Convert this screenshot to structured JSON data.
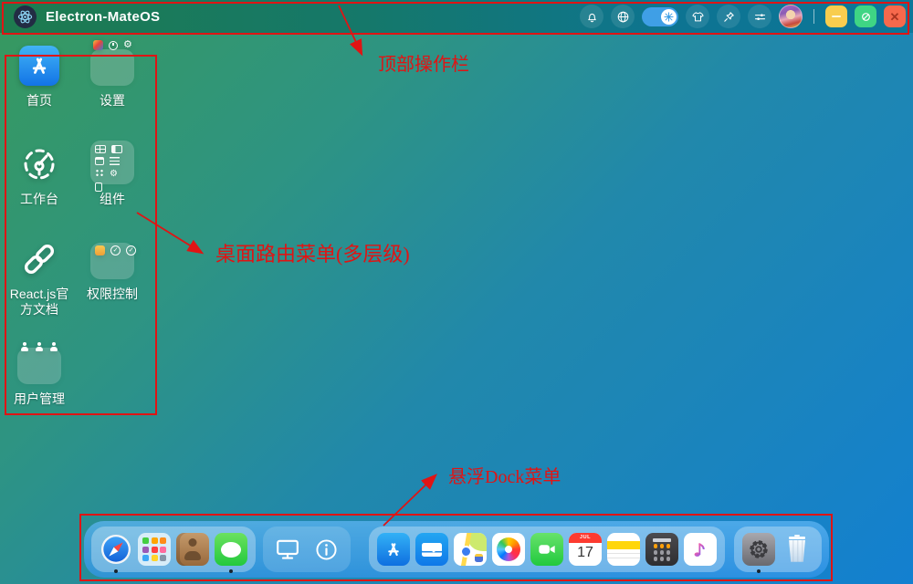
{
  "window": {
    "title": "Electron-MateOS"
  },
  "topbar": {
    "icon_names": [
      "app-logo-atom",
      "notifications-bell",
      "language-globe",
      "snow-effect-toggle-on",
      "theme-tshirt",
      "pin",
      "preferences-sliders",
      "user-avatar",
      "divider",
      "minimize",
      "maximize",
      "close"
    ]
  },
  "desktop": {
    "icons": [
      {
        "label": "首页",
        "type": "app",
        "icon": "app-store-a"
      },
      {
        "label": "设置",
        "type": "folder",
        "mini_icons": [
          "colorful-app",
          "clock",
          "gear"
        ]
      },
      {
        "label": "工作台",
        "type": "app",
        "icon": "dashboard-gauge"
      },
      {
        "label": "组件",
        "type": "folder",
        "mini_icons": [
          "table",
          "card",
          "window",
          "list",
          "grid",
          "gear",
          "document"
        ]
      },
      {
        "label": "React.js官方文档",
        "type": "app",
        "icon": "link-chain"
      },
      {
        "label": "权限控制",
        "type": "folder",
        "mini_icons": [
          "user-badge",
          "shield-check",
          "shield-check"
        ]
      },
      {
        "label": "用户管理",
        "type": "folder",
        "mini_icons": [
          "user",
          "user",
          "user"
        ]
      }
    ]
  },
  "annotations": [
    {
      "text": "顶部操作栏"
    },
    {
      "text": "桌面路由菜单(多层级)"
    },
    {
      "text": "悬浮Dock菜单"
    }
  ],
  "dock": {
    "groups": [
      {
        "items": [
          {
            "name": "safari",
            "running": true
          },
          {
            "name": "launchpad",
            "running": false
          },
          {
            "name": "contacts",
            "running": false
          },
          {
            "name": "messages",
            "running": true
          }
        ]
      },
      {
        "items": [
          {
            "name": "display",
            "running": false
          },
          {
            "name": "info",
            "running": false
          }
        ]
      },
      {
        "items": [
          {
            "name": "app-store",
            "running": false
          },
          {
            "name": "mail",
            "running": false
          },
          {
            "name": "maps",
            "running": true
          },
          {
            "name": "photos",
            "running": false
          },
          {
            "name": "facetime",
            "running": false
          },
          {
            "name": "calendar",
            "running": false
          },
          {
            "name": "notes",
            "running": false
          },
          {
            "name": "calculator",
            "running": false
          },
          {
            "name": "music",
            "running": false
          }
        ]
      },
      {
        "items": [
          {
            "name": "settings",
            "running": true
          },
          {
            "name": "trash",
            "running": false
          }
        ]
      }
    ],
    "calendar": {
      "month": "JUL",
      "day": "17"
    }
  },
  "colors": {
    "annotation_red": "#e01414",
    "topbar_gradient_left": "#1e7b4e",
    "topbar_gradient_right": "#0c7799",
    "desktop_gradient_topleft": "#37995e",
    "desktop_gradient_bottomright": "#1380d0",
    "toggle_on": "#3f9fe6",
    "minimize_button": "#f8cd4e",
    "maximize_button": "#3fd584",
    "close_button": "#f7694c"
  }
}
